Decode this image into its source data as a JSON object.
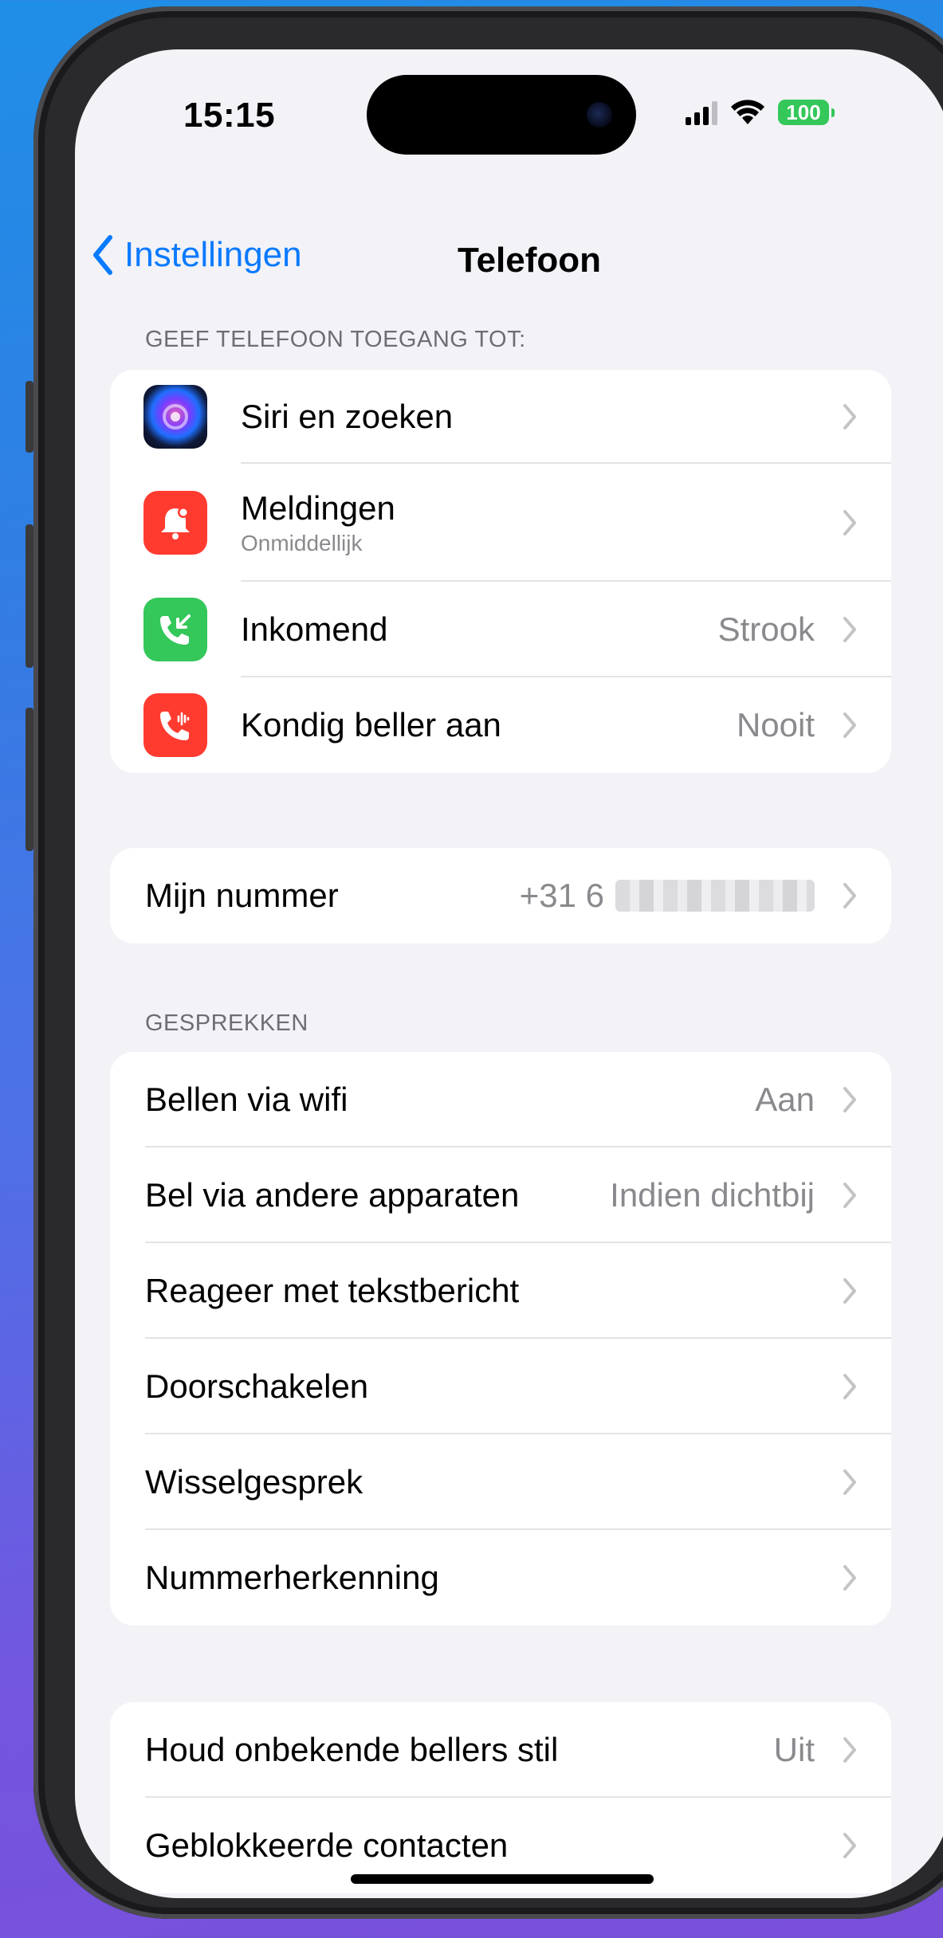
{
  "status": {
    "time": "15:15",
    "battery": "100",
    "wifi_icon": "wifi-icon",
    "signal_icon": "cellular-signal-icon"
  },
  "nav": {
    "back_label": "Instellingen",
    "title": "Telefoon"
  },
  "access_section": {
    "header": "GEEF TELEFOON TOEGANG TOT:",
    "items": [
      {
        "label": "Siri en zoeken",
        "icon": "siri-icon",
        "icon_color": "#1c1c1e"
      },
      {
        "label": "Meldingen",
        "sub": "Onmiddellijk",
        "icon": "notifications-bell-icon",
        "icon_color": "#ff3b30"
      },
      {
        "label": "Inkomend",
        "value": "Strook",
        "icon": "incoming-call-icon",
        "icon_color": "#34c759"
      },
      {
        "label": "Kondig beller aan",
        "value": "Nooit",
        "icon": "announce-caller-icon",
        "icon_color": "#ff3b30"
      }
    ]
  },
  "my_number": {
    "label": "Mijn nummer",
    "value_prefix": "+31 6"
  },
  "calls_section": {
    "header": "GESPREKKEN",
    "items": [
      {
        "label": "Bellen via wifi",
        "value": "Aan"
      },
      {
        "label": "Bel via andere apparaten",
        "value": "Indien dichtbij"
      },
      {
        "label": "Reageer met tekstbericht"
      },
      {
        "label": "Doorschakelen"
      },
      {
        "label": "Wisselgesprek"
      },
      {
        "label": "Nummerherkenning"
      }
    ]
  },
  "blocking_section": {
    "items": [
      {
        "label": "Houd onbekende bellers stil",
        "value": "Uit"
      },
      {
        "label": "Geblokkeerde contacten"
      }
    ]
  },
  "colors": {
    "accent": "#0a7aff",
    "background": "#f2f2f7",
    "battery": "#34c759"
  }
}
